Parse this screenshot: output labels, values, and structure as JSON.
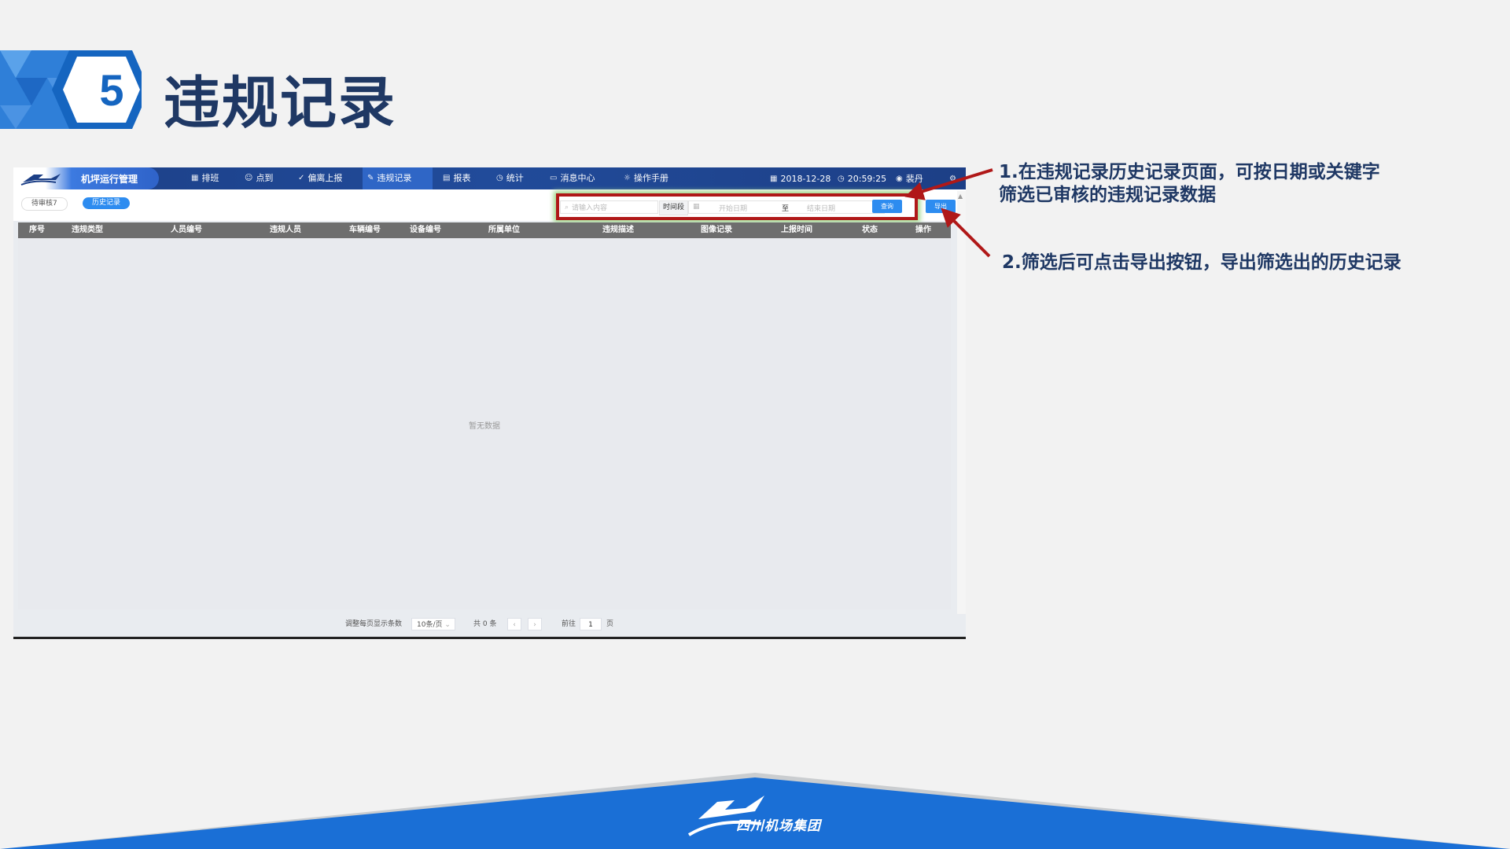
{
  "slide": {
    "number": "5",
    "title": "违规记录",
    "annotation_1_line1": "1.在违规记录历史记录页面，可按日期或关键字",
    "annotation_1_line2": "筛选已审核的违规记录数据",
    "annotation_2": "2.筛选后可点击导出按钮，导出筛选出的历史记录",
    "footer_brand": "四川机场集团",
    "colors": {
      "accent_blue": "#1565c0",
      "title_navy": "#1f3864",
      "arrow_red": "#b01818",
      "nav_blue": "#214b9a",
      "primary_button": "#2d8cf0"
    }
  },
  "app": {
    "brand": "机坪运行管理",
    "nav": [
      {
        "icon": "calendar-icon",
        "label": "排班"
      },
      {
        "icon": "user-icon",
        "label": "点到"
      },
      {
        "icon": "check-circle-icon",
        "label": "偏离上报"
      },
      {
        "icon": "edit-icon",
        "label": "违规记录"
      },
      {
        "icon": "report-icon",
        "label": "报表"
      },
      {
        "icon": "clock-icon",
        "label": "统计"
      },
      {
        "icon": "message-icon",
        "label": "消息中心"
      },
      {
        "icon": "bulb-icon",
        "label": "操作手册"
      }
    ],
    "active_nav": "违规记录",
    "date": "2018-12-28",
    "time": "20:59:25",
    "user": "裴丹",
    "tabs": {
      "pending": "待审核7",
      "history": "历史记录"
    },
    "filters": {
      "search_placeholder": "请输入内容",
      "time_label": "时间段",
      "start_placeholder": "开始日期",
      "range_sep": "至",
      "end_placeholder": "结束日期",
      "query_button": "查询",
      "export_button": "导出"
    },
    "table": {
      "columns": [
        "序号",
        "违规类型",
        "人员编号",
        "违规人员",
        "车辆编号",
        "设备编号",
        "所属单位",
        "违规描述",
        "图像记录",
        "上报时间",
        "状态",
        "操作"
      ],
      "rows": [],
      "empty_text": "暂无数据"
    },
    "pagination": {
      "page_size_label": "调整每页显示条数",
      "page_size": "10条/页",
      "total": "共 0 条",
      "prev": "‹",
      "next": "›",
      "goto_label": "前往",
      "current_page": "1",
      "page_suffix": "页"
    }
  }
}
